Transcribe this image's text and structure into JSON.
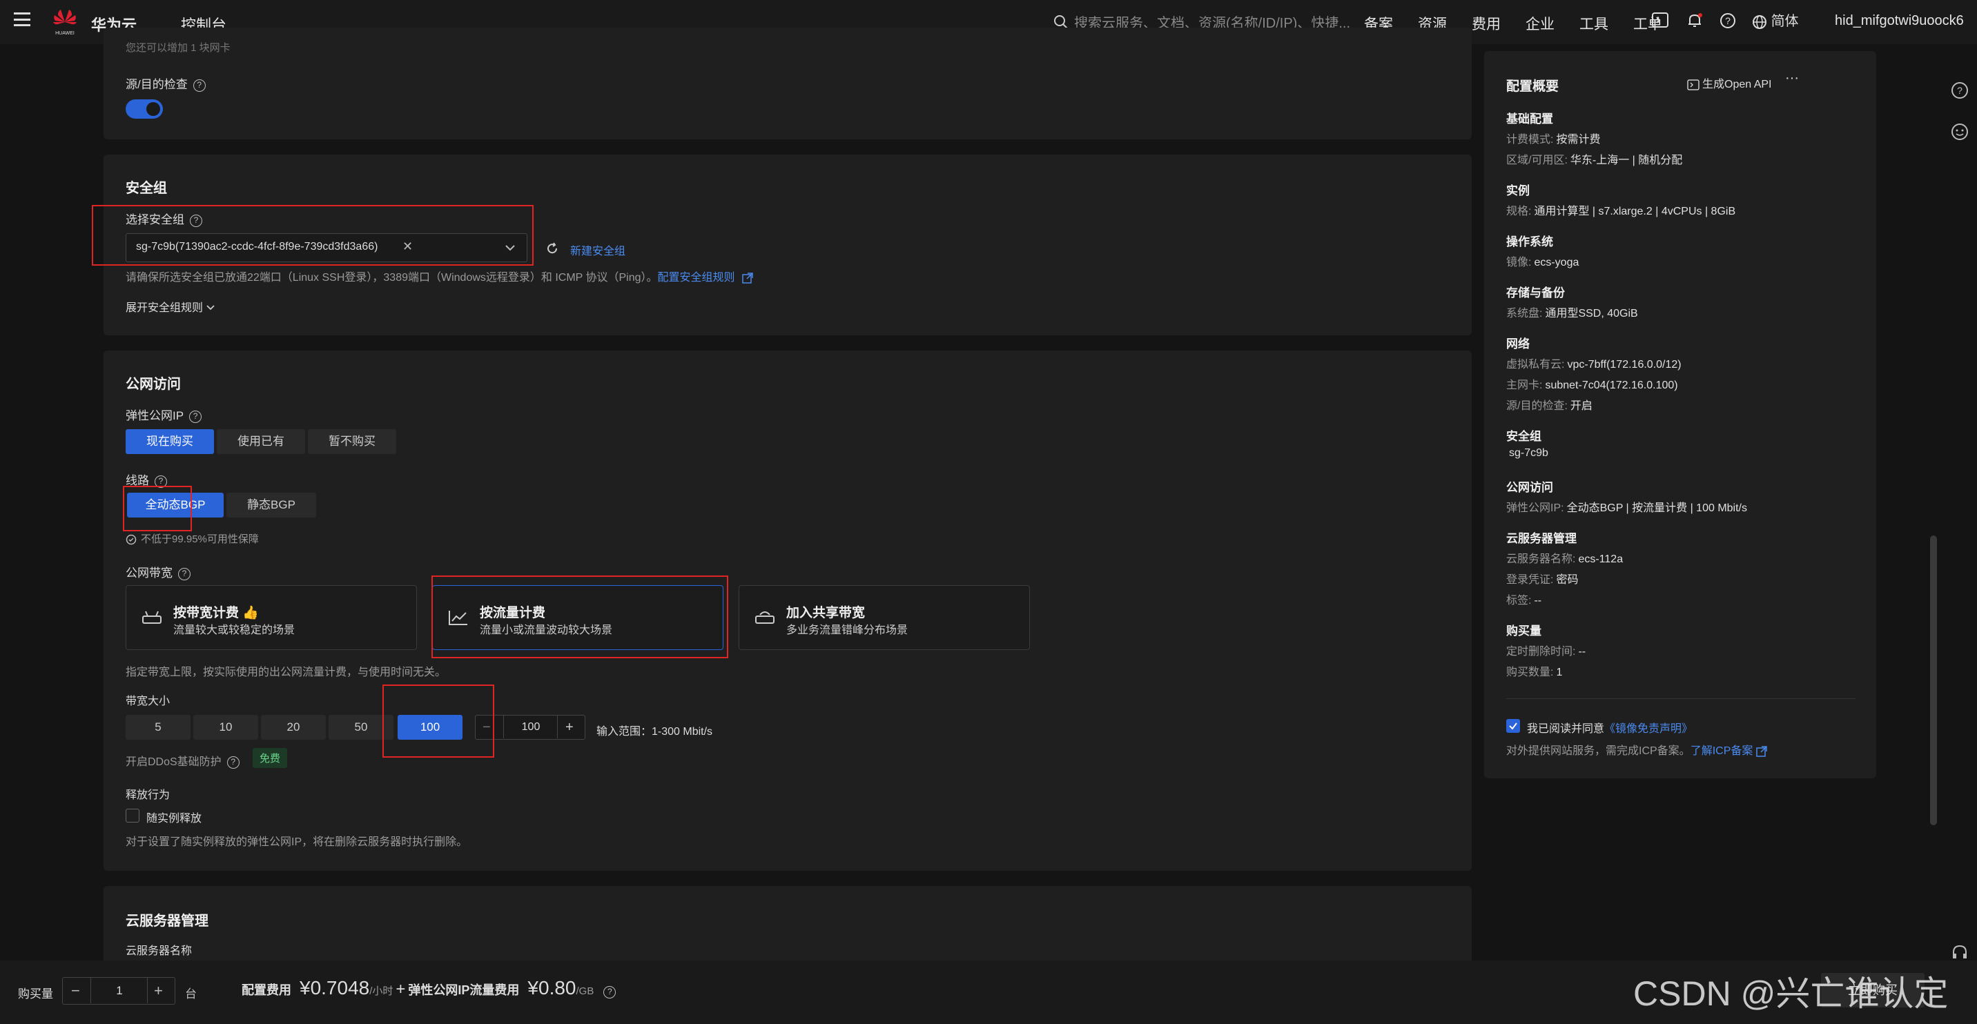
{
  "topbar": {
    "brand": "华为云",
    "logo_text": "HUAWEI",
    "console": "控制台",
    "search_placeholder": "搜索云服务、文档、资源(名称/ID/IP)、快捷...",
    "nav": [
      "备案",
      "资源",
      "费用",
      "企业",
      "工具",
      "工单"
    ],
    "lang": "简体",
    "user": "hid_mifgotwi9uoock6"
  },
  "eni": {
    "note": "您还可以增加 1 块网卡",
    "src_dst_label": "源/目的检查"
  },
  "sg": {
    "title": "安全组",
    "select_label": "选择安全组",
    "selected": "sg-7c9b(71390ac2-ccdc-4fcf-8f9e-739cd3fd3a66)",
    "new_link": "新建安全组",
    "hint": "请确保所选安全组已放通22端口（Linux SSH登录），3389端口（Windows远程登录）和 ICMP 协议（Ping）。",
    "hint_link": "配置安全组规则",
    "expand": "展开安全组规则"
  },
  "pub": {
    "title": "公网访问",
    "eip_label": "弹性公网IP",
    "eip_options": [
      "现在购买",
      "使用已有",
      "暂不购买"
    ],
    "line_label": "线路",
    "line_options": [
      "全动态BGP",
      "静态BGP"
    ],
    "sla": "不低于99.95%可用性保障",
    "bw_label": "公网带宽",
    "bw_cards": [
      {
        "title": "按带宽计费",
        "desc": "流量较大或较稳定的场景"
      },
      {
        "title": "按流量计费",
        "desc": "流量小或流量波动较大场景"
      },
      {
        "title": "加入共享带宽",
        "desc": "多业务流量错峰分布场景"
      }
    ],
    "bw_hint": "指定带宽上限，按实际使用的出公网流量计费，与使用时间无关。",
    "size_label": "带宽大小",
    "sizes": [
      "5",
      "10",
      "20",
      "50",
      "100"
    ],
    "size_value": "100",
    "range": "输入范围：1-300 Mbit/s",
    "ddos_label": "开启DDoS基础防护",
    "ddos_badge": "免费",
    "release_label": "释放行为",
    "release_check": "随实例释放",
    "release_hint": "对于设置了随实例释放的弹性公网IP，将在删除云服务器时执行删除。"
  },
  "mgmt": {
    "title": "云服务器管理",
    "name_label": "云服务器名称"
  },
  "summary": {
    "title": "配置概要",
    "api": "生成Open API",
    "sections": [
      {
        "title": "基础配置",
        "rows": [
          [
            "计费模式:",
            "按需计费"
          ],
          [
            "区域/可用区:",
            "华东-上海一 | 随机分配"
          ]
        ]
      },
      {
        "title": "实例",
        "rows": [
          [
            "规格:",
            "通用计算型 | s7.xlarge.2 | 4vCPUs | 8GiB"
          ]
        ]
      },
      {
        "title": "操作系统",
        "rows": [
          [
            "镜像:",
            "ecs-yoga"
          ]
        ]
      },
      {
        "title": "存储与备份",
        "rows": [
          [
            "系统盘:",
            "通用型SSD, 40GiB"
          ]
        ]
      },
      {
        "title": "网络",
        "rows": [
          [
            "虚拟私有云:",
            "vpc-7bff(172.16.0.0/12)"
          ],
          [
            "主网卡:",
            "subnet-7c04(172.16.0.100)"
          ],
          [
            "源/目的检查:",
            "开启"
          ]
        ]
      },
      {
        "title": "安全组",
        "rows": [
          [
            "",
            "sg-7c9b"
          ]
        ]
      },
      {
        "title": "公网访问",
        "rows": [
          [
            "弹性公网IP:",
            "全动态BGP | 按流量计费 | 100 Mbit/s"
          ]
        ]
      },
      {
        "title": "云服务器管理",
        "rows": [
          [
            "云服务器名称:",
            "ecs-112a"
          ],
          [
            "登录凭证:",
            "密码"
          ],
          [
            "标签:",
            "--"
          ]
        ]
      },
      {
        "title": "购买量",
        "rows": [
          [
            "定时删除时间:",
            "--"
          ],
          [
            "购买数量:",
            "1"
          ]
        ]
      }
    ],
    "agree": "我已阅读并同意",
    "agree_link": "《镜像免责声明》",
    "icp": "对外提供网站服务，需完成ICP备案。",
    "icp_link": "了解ICP备案"
  },
  "bottom": {
    "qty_label": "购买量",
    "qty": "1",
    "unit": "台",
    "fee_label": "配置费用",
    "fee": "¥0.7048",
    "fee_unit": "/小时",
    "plus": "+",
    "eip_fee_label": "弹性公网IP流量费用",
    "eip_fee": "¥0.80",
    "eip_fee_unit": "/GB",
    "buy": "立即购买"
  },
  "watermark": "CSDN @兴亡谁认定"
}
